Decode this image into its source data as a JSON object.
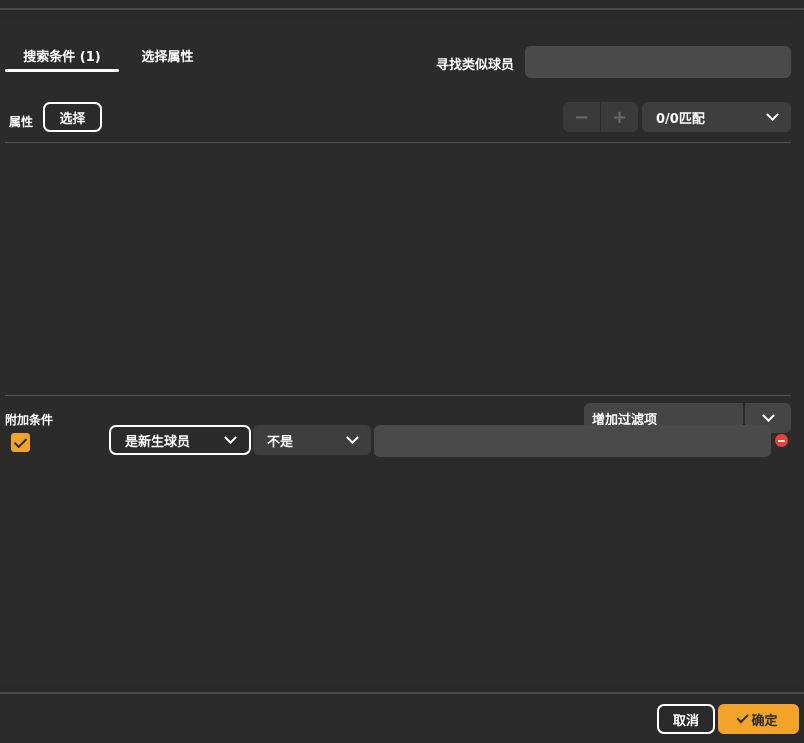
{
  "tabs": [
    {
      "label": "搜索条件 (1)",
      "active": true
    },
    {
      "label": "选择属性",
      "active": false
    }
  ],
  "similar": {
    "label": "寻找类似球员",
    "value": ""
  },
  "attributes": {
    "label": "属性",
    "select_label": "选择"
  },
  "stepper": {
    "minus": "−",
    "plus": "+"
  },
  "match": {
    "value": "0/0匹配"
  },
  "extra": {
    "label": "附加条件",
    "add_filter_label": "增加过滤项",
    "filter": {
      "checked": true,
      "field": "是新生球员",
      "operator": "不是",
      "value": ""
    }
  },
  "footer": {
    "cancel_label": "取消",
    "ok_label": "确定"
  },
  "colors": {
    "accent": "#f2a32a",
    "background": "#2b2b2b",
    "input": "#4a4a4a",
    "remove": "#e8413a"
  },
  "icons": [
    "chevron-down-icon",
    "checkbox-checked-icon",
    "remove-circle-icon",
    "checkmark-icon"
  ]
}
